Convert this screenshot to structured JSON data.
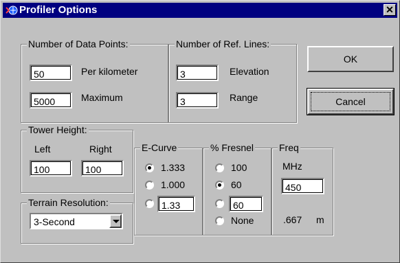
{
  "window": {
    "title": "Profiler Options",
    "close_label": "✕"
  },
  "data_points": {
    "legend": "Number of Data Points:",
    "per_km_value": "50",
    "per_km_label": "Per kilometer",
    "max_value": "5000",
    "max_label": "Maximum"
  },
  "ref_lines": {
    "legend": "Number of Ref. Lines:",
    "elevation_value": "3",
    "elevation_label": "Elevation",
    "range_value": "3",
    "range_label": "Range"
  },
  "buttons": {
    "ok": "OK",
    "cancel": "Cancel"
  },
  "tower": {
    "legend": "Tower Height:",
    "left_label": "Left",
    "right_label": "Right",
    "left_value": "100",
    "right_value": "100"
  },
  "terrain": {
    "legend": "Terrain Resolution:",
    "selected": "3-Second"
  },
  "ecurve": {
    "legend": "E-Curve",
    "options": [
      "1.333",
      "1.000"
    ],
    "custom_value": "1.33",
    "selected_index": 0
  },
  "fresnel": {
    "legend": "% Fresnel",
    "options": [
      "100",
      "60"
    ],
    "custom_value": "60",
    "none_label": "None",
    "selected_index": 1
  },
  "freq": {
    "legend": "Freq",
    "unit": "MHz",
    "value": "450",
    "wavelength": ".667",
    "wavelength_unit": "m"
  }
}
